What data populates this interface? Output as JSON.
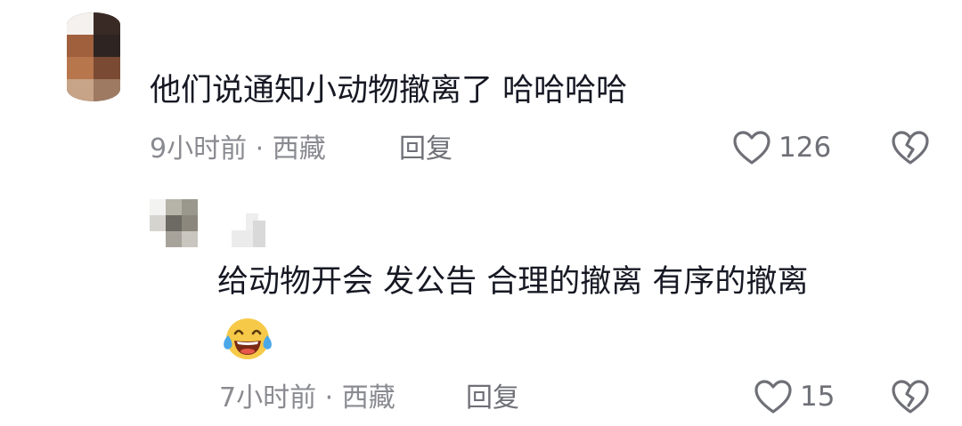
{
  "comments": [
    {
      "text": "他们说通知小动物撤离了 哈哈哈哈",
      "meta": "9小时前 · 西藏",
      "reply_label": "回复",
      "likes": "126",
      "like_icon": "heart-outline-icon",
      "dislike_icon": "broken-heart-icon"
    },
    {
      "text": "给动物开会 发公告 合理的撤离 有序的撤离",
      "emoji": "tears-of-joy-emoji",
      "meta": "7小时前 · 西藏",
      "reply_label": "回复",
      "likes": "15",
      "like_icon": "heart-outline-icon",
      "dislike_icon": "broken-heart-icon"
    }
  ],
  "colors": {
    "text": "#161823",
    "meta": "#8a8b91",
    "icon": "#6f7077",
    "emoji_face": "#f7c948",
    "emoji_tear": "#4aa8e8"
  }
}
